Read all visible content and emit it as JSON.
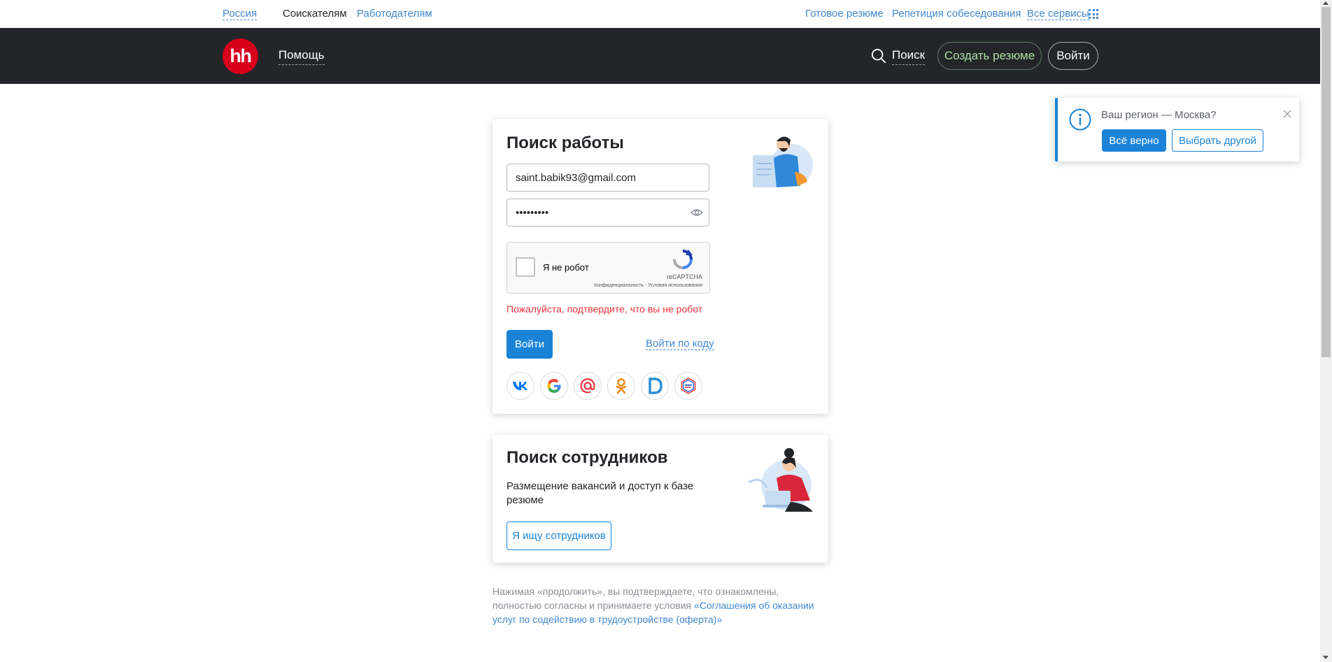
{
  "topbar": {
    "region": "Россия",
    "seekers": "Соискателям",
    "employers": "Работодателям",
    "ready_resume": "Готовое резюме",
    "interview": "Репетиция собеседования",
    "all_services": "Все сервисы"
  },
  "header": {
    "logo": "hh",
    "help": "Помощь",
    "search": "Поиск",
    "create_resume": "Создать резюме",
    "login": "Войти"
  },
  "login_card": {
    "title": "Поиск работы",
    "email_value": "saint.babik93@gmail.com",
    "password_value": "•••••••••",
    "captcha_label": "Я не робот",
    "captcha_brand": "reCAPTCHA",
    "captcha_terms": "Конфиденциальность - Условия использования",
    "error": "Пожалуйста, подтвердите, что вы не робот",
    "login_button": "Войти",
    "code_login": "Войти по коду",
    "socials": [
      "vk-icon",
      "google-icon",
      "mailru-icon",
      "ok-icon",
      "d-icon",
      "gosuslugi-icon"
    ]
  },
  "employer_card": {
    "title": "Поиск сотрудников",
    "description": "Размещение вакансий и доступ к базе резюме",
    "button": "Я ищу сотрудников"
  },
  "terms": {
    "text": "Нажимая «продолжить», вы подтверждаете, что ознакомлены, полностью согласны и принимаете условия ",
    "link": "«Соглашения об оказании услуг по содействию в трудоустройстве (оферта)»"
  },
  "region_popup": {
    "question": "Ваш регион — Москва?",
    "confirm": "Всё верно",
    "choose_other": "Выбрать другой"
  },
  "colors": {
    "header_bg": "#232529",
    "accent_blue": "#1a83d8",
    "link_blue": "#4188cd",
    "brand_red": "#d6001c",
    "error_red": "#e8333c"
  }
}
